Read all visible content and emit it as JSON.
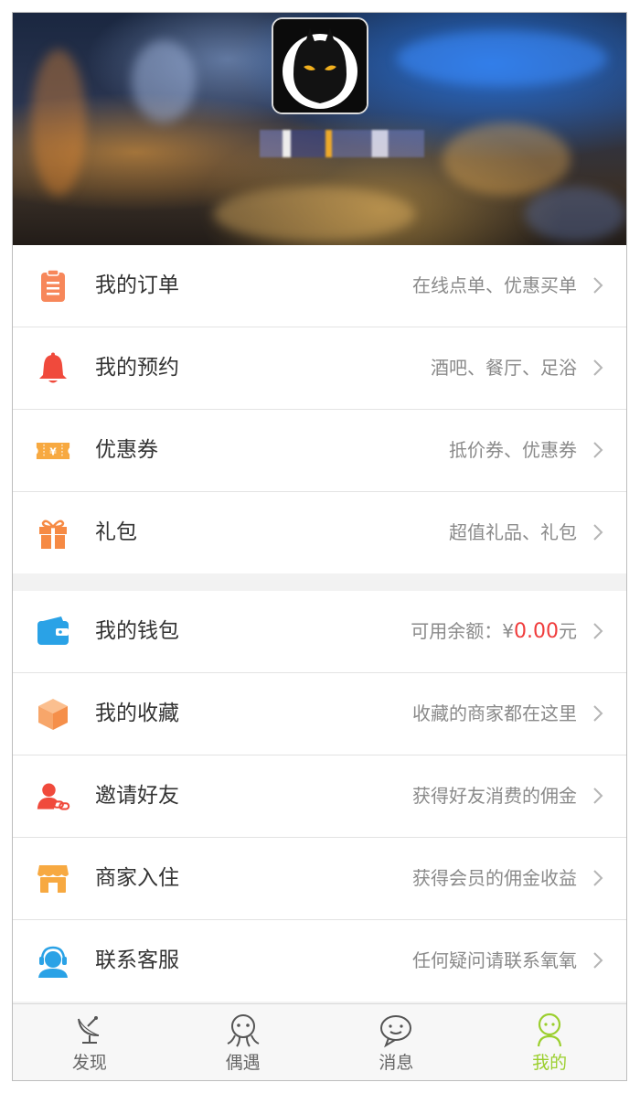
{
  "header": {
    "username": "██ █ ██"
  },
  "menu_group_1": [
    {
      "label": "我的订单",
      "desc": "在线点单、优惠买单",
      "icon": "clipboard-icon",
      "color": "#f7875a"
    },
    {
      "label": "我的预约",
      "desc": "酒吧、餐厅、足浴",
      "icon": "bell-icon",
      "color": "#f04a3c"
    },
    {
      "label": "优惠券",
      "desc": "抵价券、优惠券",
      "icon": "coupon-icon",
      "color": "#f7a941"
    },
    {
      "label": "礼包",
      "desc": "超值礼品、礼包",
      "icon": "gift-icon",
      "color": "#f68a44"
    }
  ],
  "menu_group_2": [
    {
      "label": "我的钱包",
      "desc_prefix": "可用余额：¥",
      "amount": "0.00",
      "desc_suffix": "元",
      "icon": "wallet-icon",
      "color": "#2aa2e6"
    },
    {
      "label": "我的收藏",
      "desc": "收藏的商家都在这里",
      "icon": "box-icon",
      "color": "#f7a66a"
    },
    {
      "label": "邀请好友",
      "desc": "获得好友消费的佣金",
      "icon": "user-link-icon",
      "color": "#f04a3c"
    },
    {
      "label": "商家入住",
      "desc": "获得会员的佣金收益",
      "icon": "store-icon",
      "color": "#f7a941"
    },
    {
      "label": "联系客服",
      "desc": "任何疑问请联系氧氧",
      "icon": "headset-icon",
      "color": "#2aa2e6"
    }
  ],
  "tabs": [
    {
      "label": "发现",
      "icon": "satellite-dish-icon",
      "active": false
    },
    {
      "label": "偶遇",
      "icon": "meet-icon",
      "active": false
    },
    {
      "label": "消息",
      "icon": "chat-icon",
      "active": false
    },
    {
      "label": "我的",
      "icon": "person-icon",
      "active": true
    }
  ],
  "colors": {
    "active_tab": "#9bcf2e",
    "amount": "#f03c3c"
  }
}
